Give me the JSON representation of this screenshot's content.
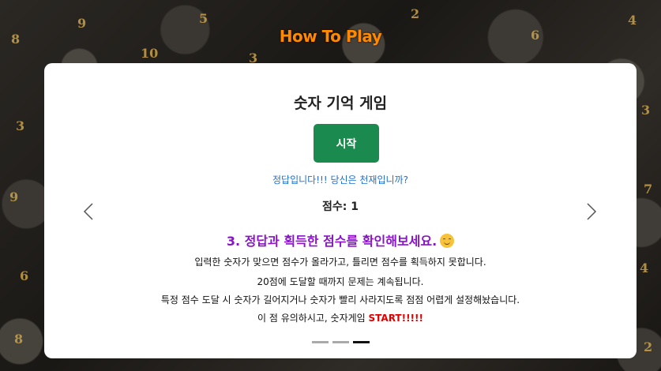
{
  "header": {
    "title": "How To Play"
  },
  "game": {
    "title": "숫자 기억 게임",
    "start_label": "시작",
    "status": "정답입니다!!! 당신은 천재입니까?",
    "score_label": "점수: 1"
  },
  "slide": {
    "heading": "3. 정답과 획득한 점수를 확인해보세요.",
    "emoji_icon": "smiling-face-icon",
    "lines": [
      "입력한 숫자가 맞으면 점수가 올라가고, 틀리면 점수를 획득하지 못합니다.",
      "20점에 도달할 때까지 문제는 계속됩니다.",
      "특정 점수 도달 시 숫자가 길어지거나 숫자가 빨리 사라지도록 점점 어렵게 설정해놨습니다."
    ],
    "last_line_prefix": "이 점 유의하시고, 숫자게임 ",
    "last_line_highlight": "START!!!!!"
  },
  "carousel": {
    "prev_icon": "chevron-left-icon",
    "next_icon": "chevron-right-icon",
    "indicator_count": 3,
    "active_index": 2
  },
  "colors": {
    "title_orange": "#ff8a00",
    "start_green": "#1b8a4f",
    "status_blue": "#1f6fd1",
    "heading_purple": "#8a12c9",
    "highlight_red": "#e00000"
  },
  "background": {
    "dice_numbers": [
      "8",
      "9",
      "10",
      "3",
      "6",
      "4",
      "2",
      "5",
      "3",
      "9",
      "6",
      "8",
      "3",
      "7",
      "4",
      "2"
    ]
  }
}
